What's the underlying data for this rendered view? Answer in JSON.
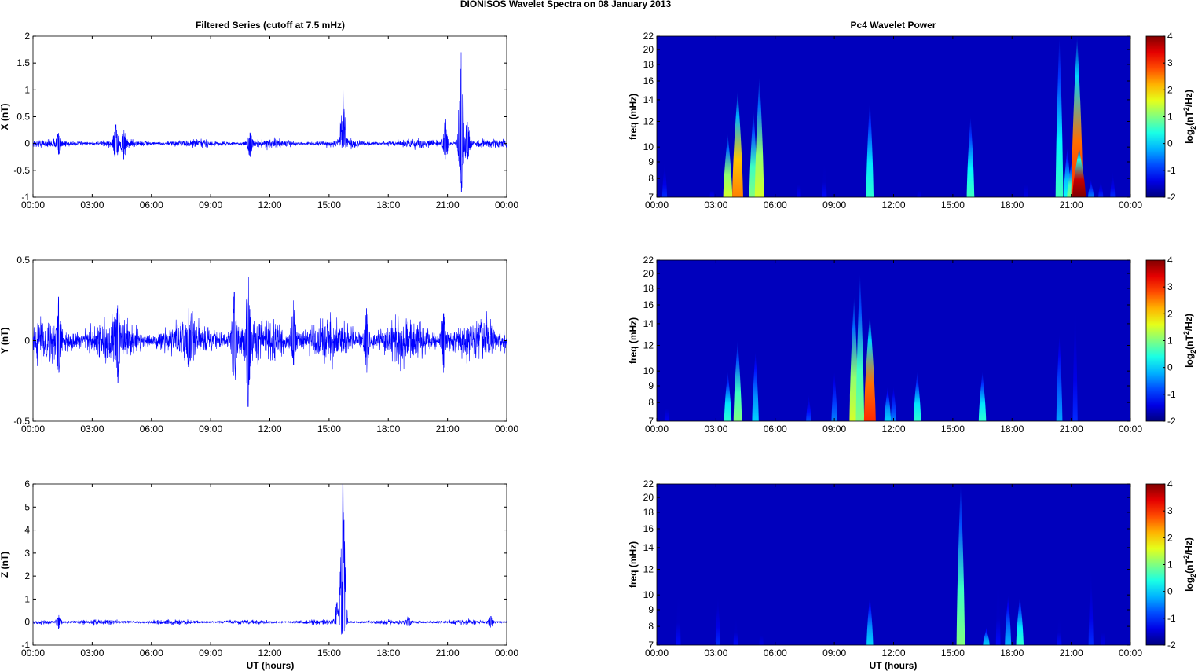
{
  "title": "DIONISOS Wavelet Spectra on 08 January   2013",
  "chart_data": {
    "left_title": "Filtered Series (cutoff at 7.5 mHz)",
    "right_title": "Pc4 Wavelet Power",
    "xlabel": "UT (hours)",
    "xticks": [
      "00:00",
      "03:00",
      "06:00",
      "09:00",
      "12:00",
      "15:00",
      "18:00",
      "21:00",
      "00:00"
    ],
    "xlim": [
      0,
      24
    ],
    "series": [
      {
        "type": "line",
        "name": "X",
        "ylabel": "X (nT)",
        "ylim": [
          -1,
          2
        ],
        "yticks": [
          "-1",
          "-0.5",
          "0",
          "0.5",
          "1",
          "1.5",
          "2"
        ],
        "ytick_values": [
          -1,
          -0.5,
          0,
          0.5,
          1,
          1.5,
          2
        ],
        "baseline_amplitude": 0.05,
        "events": [
          [
            1.3,
            0.2,
            -0.2
          ],
          [
            4.2,
            0.35,
            -0.35
          ],
          [
            4.6,
            0.25,
            -0.3
          ],
          [
            11.0,
            0.2,
            -0.25
          ],
          [
            15.7,
            1.0,
            -0.05
          ],
          [
            20.9,
            0.45,
            -0.3
          ],
          [
            21.7,
            1.7,
            -0.9
          ],
          [
            22.0,
            0.4,
            -0.4
          ]
        ],
        "color": "#0000ff"
      },
      {
        "type": "line",
        "name": "Y",
        "ylabel": "Y (nT)",
        "ylim": [
          -0.5,
          0.5
        ],
        "yticks": [
          "-0.5",
          "0",
          "0.5"
        ],
        "ytick_values": [
          -0.5,
          0,
          0.5
        ],
        "baseline_amplitude": 0.08,
        "events": [
          [
            1.3,
            0.27,
            -0.2
          ],
          [
            4.3,
            0.22,
            -0.26
          ],
          [
            7.9,
            0.2,
            -0.2
          ],
          [
            10.2,
            0.3,
            -0.3
          ],
          [
            10.9,
            0.42,
            -0.41
          ],
          [
            13.2,
            0.25,
            -0.15
          ],
          [
            16.9,
            0.2,
            -0.2
          ],
          [
            20.8,
            0.17,
            -0.2
          ]
        ],
        "color": "#0000ff"
      },
      {
        "type": "line",
        "name": "Z",
        "ylabel": "Z (nT)",
        "ylim": [
          -1,
          6
        ],
        "yticks": [
          "-1",
          "0",
          "1",
          "2",
          "3",
          "4",
          "5",
          "6"
        ],
        "ytick_values": [
          -1,
          0,
          1,
          2,
          3,
          4,
          5,
          6
        ],
        "baseline_amplitude": 0.07,
        "events": [
          [
            1.3,
            0.3,
            -0.3
          ],
          [
            15.4,
            0.85,
            -0.1
          ],
          [
            15.7,
            6.0,
            -0.8
          ],
          [
            19.0,
            0.25,
            -0.25
          ],
          [
            23.2,
            0.25,
            -0.25
          ]
        ],
        "color": "#0000ff"
      }
    ],
    "spectra": [
      {
        "type": "heatmap",
        "ylabel": "freq (mHz)",
        "ylim": [
          7,
          22
        ],
        "yscale": "log",
        "yticks": [
          "7",
          "8",
          "9",
          "10",
          "12",
          "14",
          "16",
          "18",
          "20",
          "22"
        ],
        "ytick_values": [
          7,
          8,
          9,
          10,
          12,
          14,
          16,
          18,
          20,
          22
        ],
        "colorbar_label": "log2(nT2/Hz)",
        "clim": [
          -2,
          4
        ],
        "cticks": [
          "-2",
          "-1",
          "0",
          "1",
          "2",
          "3",
          "4"
        ],
        "bursts_t_fmax_power": [
          [
            0.4,
            9,
            -1
          ],
          [
            2.8,
            8,
            -1.3
          ],
          [
            3.6,
            11,
            1.5
          ],
          [
            4.1,
            15,
            2.5
          ],
          [
            4.9,
            13,
            1
          ],
          [
            5.2,
            16.5,
            1.5
          ],
          [
            7.2,
            9,
            -1.3
          ],
          [
            8.5,
            9.5,
            -1.2
          ],
          [
            10.8,
            14,
            0.5
          ],
          [
            13.3,
            8,
            -1.4
          ],
          [
            15.9,
            12.5,
            0.6
          ],
          [
            18.7,
            9,
            -1.4
          ],
          [
            20.4,
            22,
            0.6
          ],
          [
            20.8,
            10,
            0.3
          ],
          [
            21.0,
            9,
            1
          ],
          [
            21.3,
            22,
            3
          ],
          [
            21.4,
            10,
            4
          ],
          [
            22.0,
            8,
            -0.5
          ],
          [
            22.5,
            8,
            -1
          ],
          [
            23.1,
            8.5,
            -1
          ]
        ]
      },
      {
        "type": "heatmap",
        "ylabel": "freq (mHz)",
        "ylim": [
          7,
          22
        ],
        "yscale": "log",
        "yticks": [
          "7",
          "8",
          "9",
          "10",
          "12",
          "14",
          "16",
          "18",
          "20",
          "22"
        ],
        "ytick_values": [
          7,
          8,
          9,
          10,
          12,
          14,
          16,
          18,
          20,
          22
        ],
        "colorbar_label": "log2(nT2/Hz)",
        "clim": [
          -2,
          4
        ],
        "cticks": [
          "-2",
          "-1",
          "0",
          "1",
          "2",
          "3",
          "4"
        ],
        "bursts_t_fmax_power": [
          [
            0.5,
            9,
            -1.3
          ],
          [
            3.6,
            10,
            0.5
          ],
          [
            4.1,
            12.5,
            1
          ],
          [
            5.0,
            11.5,
            0
          ],
          [
            7.7,
            8.5,
            -0.8
          ],
          [
            9.0,
            10,
            -0.5
          ],
          [
            10.0,
            17,
            1.5
          ],
          [
            10.3,
            20,
            1
          ],
          [
            10.8,
            15,
            3
          ],
          [
            11.7,
            9,
            0
          ],
          [
            12.0,
            9,
            -0.5
          ],
          [
            13.2,
            10,
            0.5
          ],
          [
            16.5,
            10,
            0.5
          ],
          [
            20.4,
            13,
            -0.3
          ],
          [
            21.2,
            16,
            -1
          ]
        ]
      },
      {
        "type": "heatmap",
        "ylabel": "freq (mHz)",
        "ylim": [
          7,
          22
        ],
        "yscale": "log",
        "yticks": [
          "7",
          "8",
          "9",
          "10",
          "12",
          "14",
          "16",
          "18",
          "20",
          "22"
        ],
        "ytick_values": [
          7,
          8,
          9,
          10,
          12,
          14,
          16,
          18,
          20,
          22
        ],
        "colorbar_label": "log2(nT2/Hz)",
        "clim": [
          -2,
          4
        ],
        "cticks": [
          "-2",
          "-1",
          "0",
          "1",
          "2",
          "3",
          "4"
        ],
        "bursts_t_fmax_power": [
          [
            1.1,
            11,
            -1.2
          ],
          [
            3.1,
            10,
            -1
          ],
          [
            4.0,
            9,
            -1.2
          ],
          [
            5.3,
            8.5,
            -1.4
          ],
          [
            10.8,
            10,
            0
          ],
          [
            15.4,
            22,
            1
          ],
          [
            16.7,
            8,
            0
          ],
          [
            17.3,
            12,
            -1.2
          ],
          [
            17.8,
            10,
            -0.2
          ],
          [
            18.4,
            10,
            0.5
          ],
          [
            20.4,
            9,
            -1.2
          ],
          [
            22.0,
            12,
            -1
          ],
          [
            22.6,
            9,
            -1.4
          ]
        ]
      }
    ]
  }
}
